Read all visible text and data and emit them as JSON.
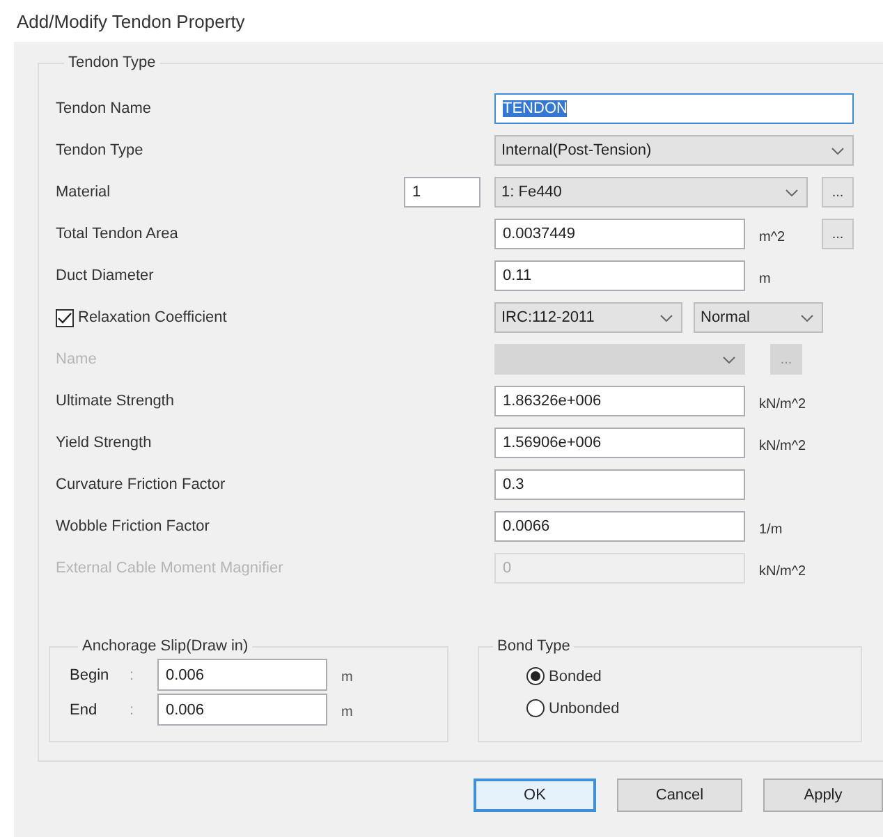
{
  "window": {
    "title": "Add/Modify Tendon Property"
  },
  "tendon_type": {
    "title": "Tendon Type",
    "rows": [
      {
        "kind": "input",
        "label": "Tendon Name",
        "value": "TENDON",
        "value_selected": true,
        "disabled": false
      },
      {
        "kind": "select",
        "label": "Tendon Type",
        "value": "Internal(Post-Tension)",
        "disabled": false
      },
      {
        "kind": "material",
        "label": "Material",
        "number": "1",
        "value": "1: Fe440",
        "more": "...",
        "disabled": false
      },
      {
        "kind": "input",
        "label": "Total Tendon Area",
        "value": "0.0037449",
        "unit": "m^2",
        "more": "...",
        "value_selected": false,
        "disabled": false
      },
      {
        "kind": "input",
        "label": "Duct Diameter",
        "value": "0.11",
        "unit": "m",
        "value_selected": false,
        "disabled": false
      },
      {
        "kind": "check",
        "label": "Relaxation Coefficient",
        "checked": true,
        "selects": [
          "IRC:112-2011",
          "Normal"
        ],
        "disabled": false
      },
      {
        "kind": "select",
        "label": "Name",
        "more": "...",
        "disabled": true
      },
      {
        "kind": "input",
        "label": "Ultimate Strength",
        "value": "1.86326e+006",
        "unit": "kN/m^2",
        "value_selected": false,
        "disabled": false
      },
      {
        "kind": "input",
        "label": "Yield Strength",
        "value": "1.56906e+006",
        "unit": "kN/m^2",
        "value_selected": false,
        "disabled": false
      },
      {
        "kind": "input",
        "label": "Curvature Friction Factor",
        "value": "0.3",
        "value_selected": false,
        "disabled": false
      },
      {
        "kind": "input",
        "label": "Wobble Friction Factor",
        "value": "0.0066",
        "unit": "1/m",
        "value_selected": false,
        "disabled": false
      },
      {
        "kind": "input",
        "label": "External Cable Moment Magnifier",
        "value": "0",
        "unit": "kN/m^2",
        "value_selected": false,
        "disabled": true
      }
    ],
    "anchorage_slip": {
      "title": "Anchorage Slip(Draw in)",
      "rows": [
        {
          "label": "Begin",
          "separator": ":",
          "value": "0.006",
          "unit": "m"
        },
        {
          "label": "End",
          "separator": ":",
          "value": "0.006",
          "unit": "m"
        }
      ]
    },
    "bond_type": {
      "title": "Bond Type",
      "options": [
        {
          "label": "Bonded",
          "selected": true
        },
        {
          "label": "Unbonded",
          "selected": false
        }
      ]
    }
  },
  "buttons": [
    {
      "label": "OK",
      "default": true
    },
    {
      "label": "Cancel",
      "default": false
    },
    {
      "label": "Apply",
      "default": false
    }
  ]
}
